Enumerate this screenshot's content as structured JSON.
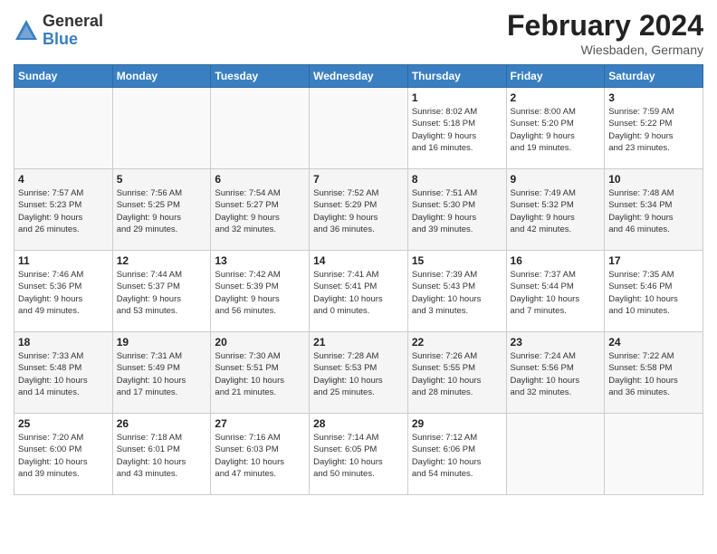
{
  "header": {
    "logo_general": "General",
    "logo_blue": "Blue",
    "month_year": "February 2024",
    "location": "Wiesbaden, Germany"
  },
  "days_of_week": [
    "Sunday",
    "Monday",
    "Tuesday",
    "Wednesday",
    "Thursday",
    "Friday",
    "Saturday"
  ],
  "weeks": [
    [
      {
        "day": "",
        "info": ""
      },
      {
        "day": "",
        "info": ""
      },
      {
        "day": "",
        "info": ""
      },
      {
        "day": "",
        "info": ""
      },
      {
        "day": "1",
        "info": "Sunrise: 8:02 AM\nSunset: 5:18 PM\nDaylight: 9 hours\nand 16 minutes."
      },
      {
        "day": "2",
        "info": "Sunrise: 8:00 AM\nSunset: 5:20 PM\nDaylight: 9 hours\nand 19 minutes."
      },
      {
        "day": "3",
        "info": "Sunrise: 7:59 AM\nSunset: 5:22 PM\nDaylight: 9 hours\nand 23 minutes."
      }
    ],
    [
      {
        "day": "4",
        "info": "Sunrise: 7:57 AM\nSunset: 5:23 PM\nDaylight: 9 hours\nand 26 minutes."
      },
      {
        "day": "5",
        "info": "Sunrise: 7:56 AM\nSunset: 5:25 PM\nDaylight: 9 hours\nand 29 minutes."
      },
      {
        "day": "6",
        "info": "Sunrise: 7:54 AM\nSunset: 5:27 PM\nDaylight: 9 hours\nand 32 minutes."
      },
      {
        "day": "7",
        "info": "Sunrise: 7:52 AM\nSunset: 5:29 PM\nDaylight: 9 hours\nand 36 minutes."
      },
      {
        "day": "8",
        "info": "Sunrise: 7:51 AM\nSunset: 5:30 PM\nDaylight: 9 hours\nand 39 minutes."
      },
      {
        "day": "9",
        "info": "Sunrise: 7:49 AM\nSunset: 5:32 PM\nDaylight: 9 hours\nand 42 minutes."
      },
      {
        "day": "10",
        "info": "Sunrise: 7:48 AM\nSunset: 5:34 PM\nDaylight: 9 hours\nand 46 minutes."
      }
    ],
    [
      {
        "day": "11",
        "info": "Sunrise: 7:46 AM\nSunset: 5:36 PM\nDaylight: 9 hours\nand 49 minutes."
      },
      {
        "day": "12",
        "info": "Sunrise: 7:44 AM\nSunset: 5:37 PM\nDaylight: 9 hours\nand 53 minutes."
      },
      {
        "day": "13",
        "info": "Sunrise: 7:42 AM\nSunset: 5:39 PM\nDaylight: 9 hours\nand 56 minutes."
      },
      {
        "day": "14",
        "info": "Sunrise: 7:41 AM\nSunset: 5:41 PM\nDaylight: 10 hours\nand 0 minutes."
      },
      {
        "day": "15",
        "info": "Sunrise: 7:39 AM\nSunset: 5:43 PM\nDaylight: 10 hours\nand 3 minutes."
      },
      {
        "day": "16",
        "info": "Sunrise: 7:37 AM\nSunset: 5:44 PM\nDaylight: 10 hours\nand 7 minutes."
      },
      {
        "day": "17",
        "info": "Sunrise: 7:35 AM\nSunset: 5:46 PM\nDaylight: 10 hours\nand 10 minutes."
      }
    ],
    [
      {
        "day": "18",
        "info": "Sunrise: 7:33 AM\nSunset: 5:48 PM\nDaylight: 10 hours\nand 14 minutes."
      },
      {
        "day": "19",
        "info": "Sunrise: 7:31 AM\nSunset: 5:49 PM\nDaylight: 10 hours\nand 17 minutes."
      },
      {
        "day": "20",
        "info": "Sunrise: 7:30 AM\nSunset: 5:51 PM\nDaylight: 10 hours\nand 21 minutes."
      },
      {
        "day": "21",
        "info": "Sunrise: 7:28 AM\nSunset: 5:53 PM\nDaylight: 10 hours\nand 25 minutes."
      },
      {
        "day": "22",
        "info": "Sunrise: 7:26 AM\nSunset: 5:55 PM\nDaylight: 10 hours\nand 28 minutes."
      },
      {
        "day": "23",
        "info": "Sunrise: 7:24 AM\nSunset: 5:56 PM\nDaylight: 10 hours\nand 32 minutes."
      },
      {
        "day": "24",
        "info": "Sunrise: 7:22 AM\nSunset: 5:58 PM\nDaylight: 10 hours\nand 36 minutes."
      }
    ],
    [
      {
        "day": "25",
        "info": "Sunrise: 7:20 AM\nSunset: 6:00 PM\nDaylight: 10 hours\nand 39 minutes."
      },
      {
        "day": "26",
        "info": "Sunrise: 7:18 AM\nSunset: 6:01 PM\nDaylight: 10 hours\nand 43 minutes."
      },
      {
        "day": "27",
        "info": "Sunrise: 7:16 AM\nSunset: 6:03 PM\nDaylight: 10 hours\nand 47 minutes."
      },
      {
        "day": "28",
        "info": "Sunrise: 7:14 AM\nSunset: 6:05 PM\nDaylight: 10 hours\nand 50 minutes."
      },
      {
        "day": "29",
        "info": "Sunrise: 7:12 AM\nSunset: 6:06 PM\nDaylight: 10 hours\nand 54 minutes."
      },
      {
        "day": "",
        "info": ""
      },
      {
        "day": "",
        "info": ""
      }
    ]
  ]
}
